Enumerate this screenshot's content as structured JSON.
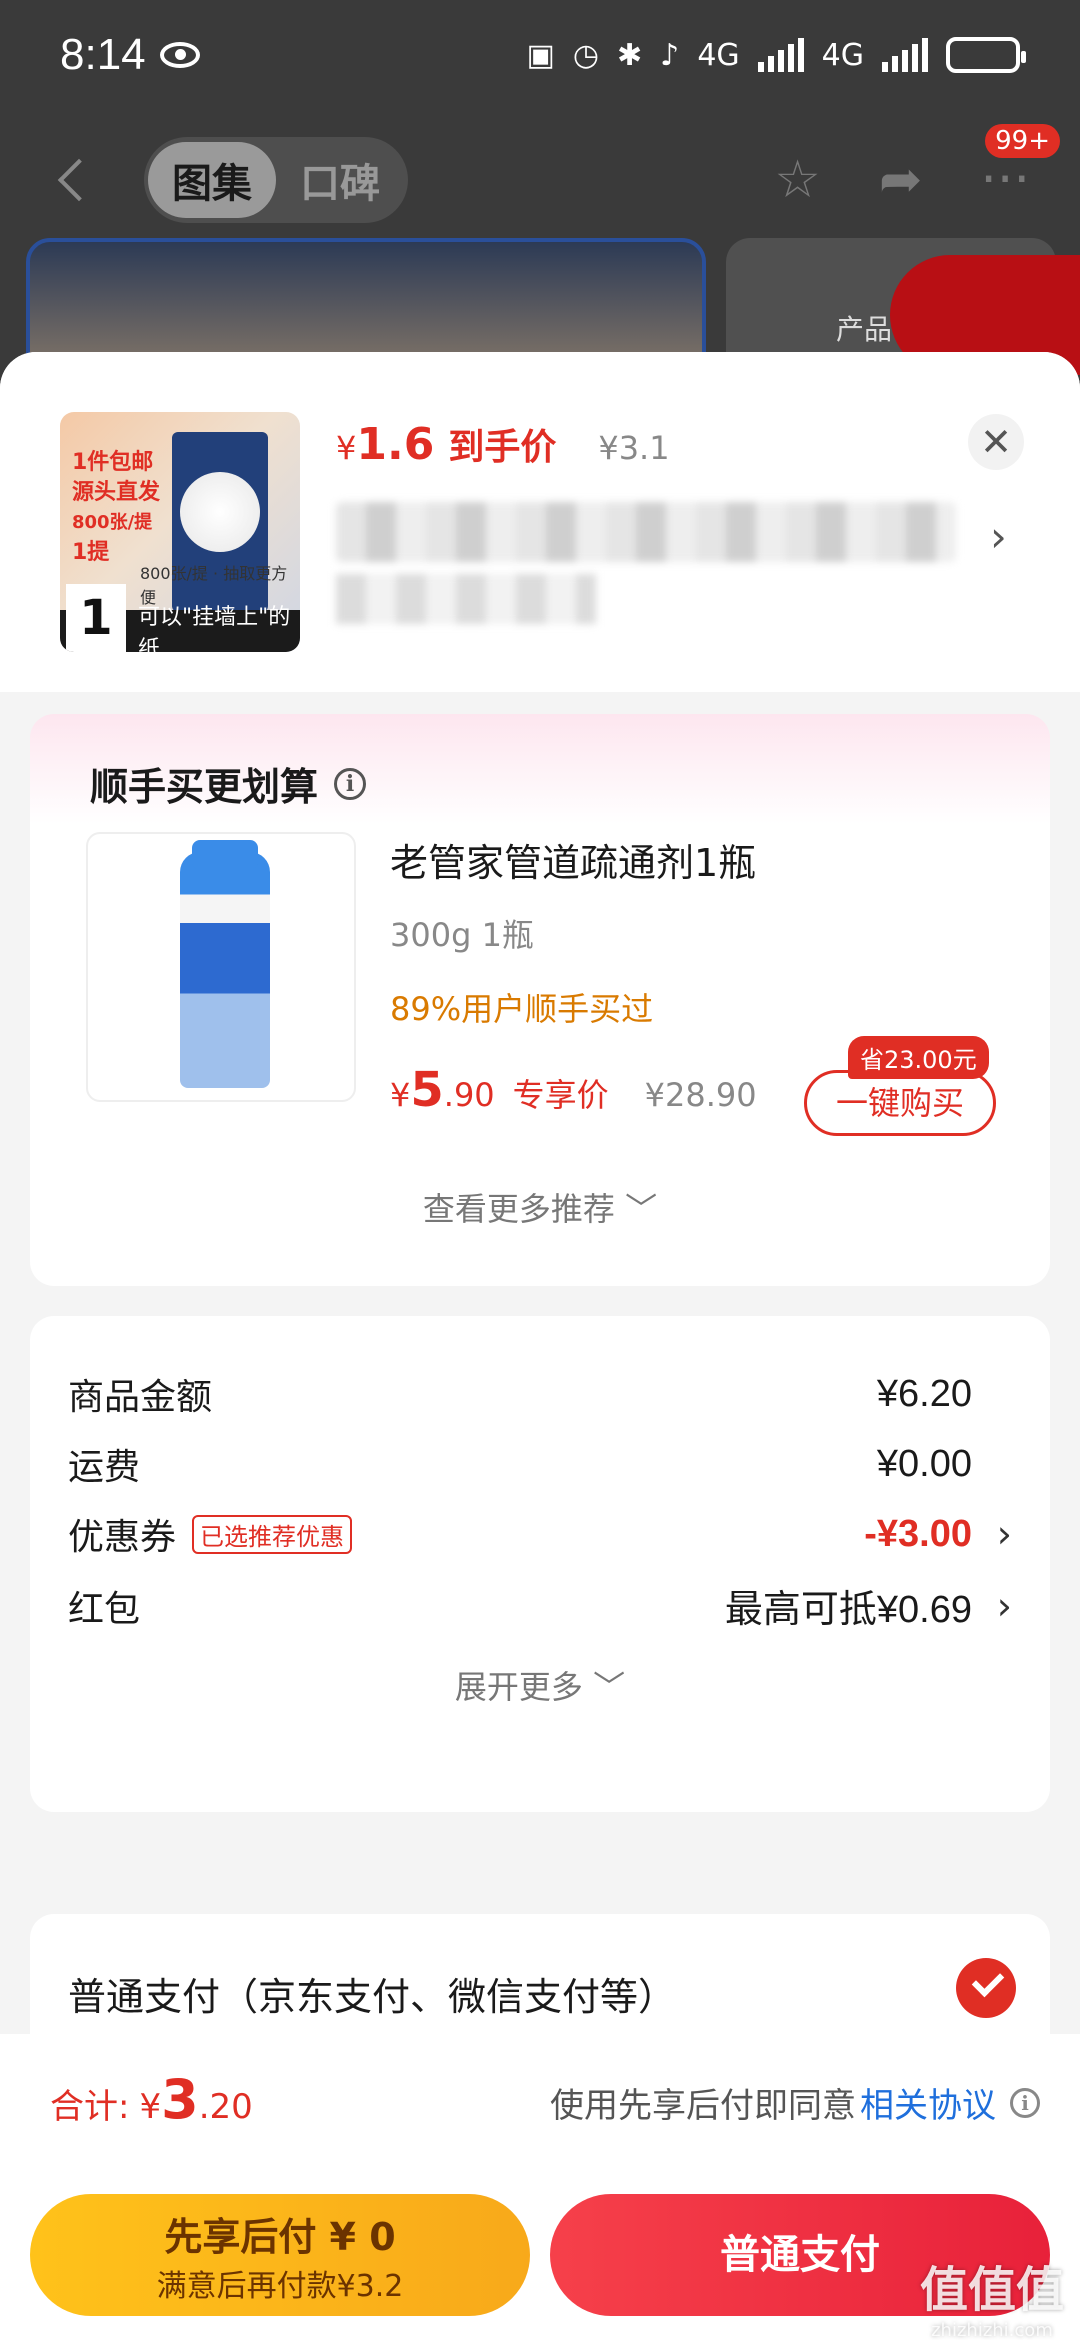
{
  "status": {
    "time": "8:14",
    "net1": "4G",
    "net2": "4G"
  },
  "nav": {
    "tabs": [
      "图集",
      "口碑"
    ],
    "badge": "99+",
    "side_text": "产品"
  },
  "product": {
    "thumb_tag_lines": [
      "1件包邮",
      "源头直发",
      "800张/提",
      "1提"
    ],
    "thumb_caption": "可以\"挂墙上\"的纸",
    "thumb_small": "800张/提 · 抽取更方便",
    "thumb_num": "1",
    "price_currency": "¥",
    "price_amount": "1.6",
    "price_label": "到手价",
    "original_price": "¥3.1"
  },
  "addon": {
    "title": "顺手买更划算",
    "name": "老管家管道疏通剂1瓶",
    "spec": "300g 1瓶",
    "popularity": "89%用户顺手买过",
    "price_currency": "¥",
    "price_int": "5",
    "price_dec": ".90",
    "price_label": "专享价",
    "original_price": "¥28.90",
    "save_badge": "省23.00元",
    "buy_button": "一键购买",
    "more": "查看更多推荐 ﹀"
  },
  "summary": {
    "rows": [
      {
        "label": "商品金额",
        "value": "¥6.20"
      },
      {
        "label": "运费",
        "value": "¥0.00"
      },
      {
        "label": "优惠券",
        "tag": "已选推荐优惠",
        "value": "-¥3.00"
      },
      {
        "label": "红包",
        "value": "最高可抵¥0.69"
      }
    ],
    "expand": "展开更多 ﹀"
  },
  "payment": {
    "option_label": "普通支付（京东支付、微信支付等）"
  },
  "bottom": {
    "total_label": "合计:",
    "total_currency": "¥",
    "total_int": "3",
    "total_dec": ".20",
    "agree_text": "使用先享后付即同意",
    "agree_link": "相关协议",
    "left_button_title": "先享后付 ¥ 0",
    "left_button_sub": "满意后再付款¥3.2",
    "right_button": "普通支付"
  },
  "watermark": {
    "main": "值值值",
    "sub": "zhizhizhi.com"
  },
  "colors": {
    "accent_red": "#e02e24",
    "yellow": "#ffc21a",
    "link_blue": "#1f6fdc"
  }
}
